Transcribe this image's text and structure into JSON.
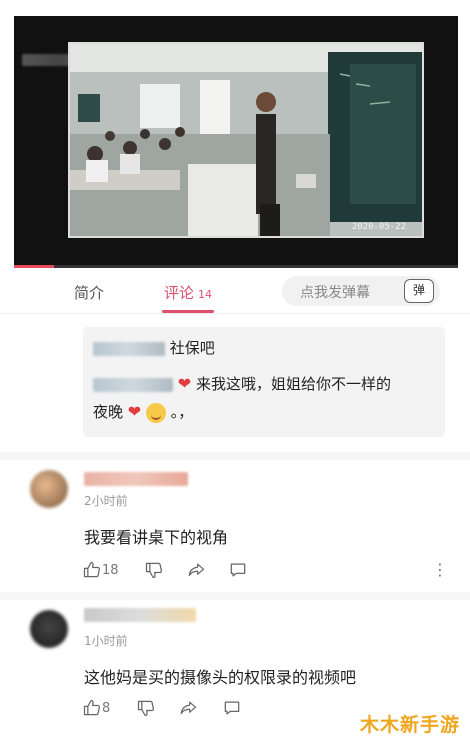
{
  "video": {
    "timestamp": "2020-05-22",
    "progress_percent": 9
  },
  "tabs": {
    "intro": "简介",
    "comments": "评论",
    "comments_count": "14",
    "danmu_placeholder": "点我发弹幕",
    "danmu_icon": "弹"
  },
  "reply_box": {
    "line1_text": "社保吧",
    "line2_text": "来我这哦，姐姐给你不一样的",
    "line3_start": "夜晚",
    "line3_end": "。，",
    "heart": "❤"
  },
  "comments": [
    {
      "time": "2小时前",
      "text": "我要看讲桌下的视角",
      "likes": "18"
    },
    {
      "time": "1小时前",
      "text": "这他妈是买的摄像头的权限录的视频吧",
      "likes": "8"
    }
  ],
  "more_glyph": "⋮",
  "watermark": "木木新手游",
  "icons": [
    "thumbs-up-icon",
    "thumbs-down-icon",
    "share-icon",
    "comment-icon",
    "more-icon",
    "danmu-icon"
  ]
}
